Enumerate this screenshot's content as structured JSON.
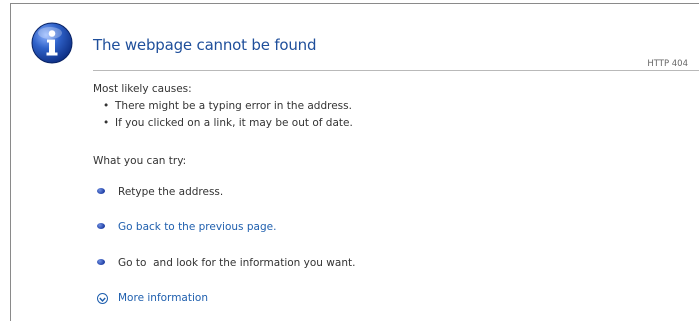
{
  "error_page": {
    "title": "The webpage cannot be found",
    "http_code": "HTTP 404",
    "causes_heading": "Most likely causes:",
    "causes": [
      "There might be a typing error in the address.",
      "If you clicked on a link, it may be out of date."
    ],
    "try_heading": "What you can try:",
    "try_items": [
      {
        "text": "Retype the address.",
        "is_link": false
      },
      {
        "text": "Go back to the previous page.",
        "is_link": true
      },
      {
        "text": "Go to  and look for the information you want.",
        "is_link": false
      }
    ],
    "more_info_label": "More information",
    "icons": {
      "info": "info-icon",
      "bullet": "bullet-icon",
      "expand": "chevron-down-circle-icon"
    },
    "colors": {
      "title": "#1f4f9b",
      "link": "#1f5fae",
      "icon_blue": "#1e4fa3"
    }
  }
}
